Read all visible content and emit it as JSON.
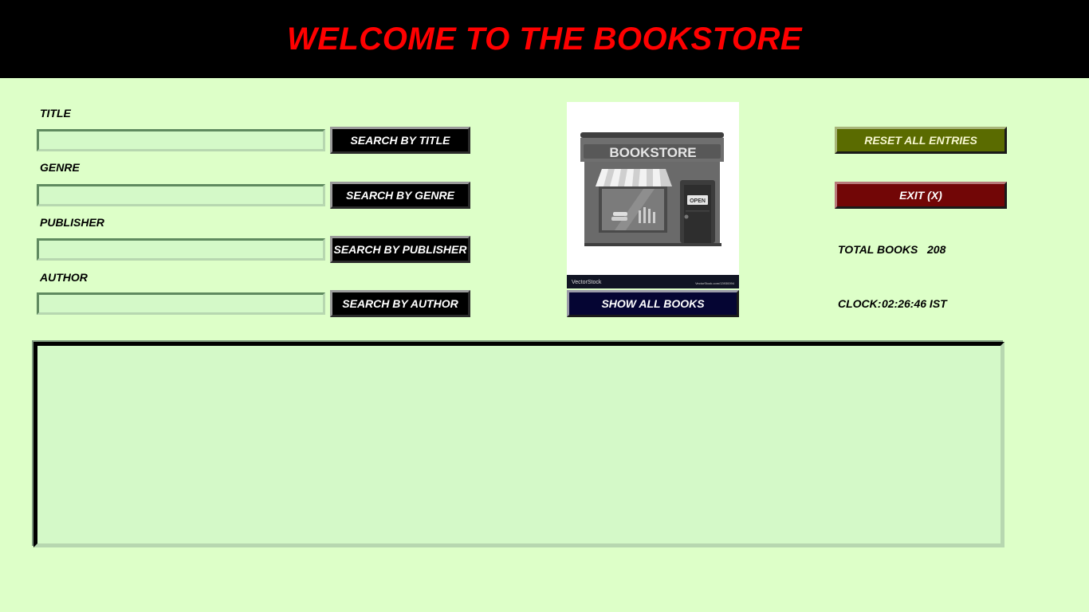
{
  "header": {
    "title": "WELCOME TO THE BOOKSTORE"
  },
  "fields": {
    "title": {
      "label": "TITLE",
      "value": "",
      "button": "SEARCH BY TITLE"
    },
    "genre": {
      "label": "GENRE",
      "value": "",
      "button": "SEARCH BY GENRE"
    },
    "publisher": {
      "label": "PUBLISHER",
      "value": "",
      "button": "SEARCH BY PUBLISHER"
    },
    "author": {
      "label": "AUTHOR",
      "value": "",
      "button": "SEARCH BY AUTHOR"
    }
  },
  "image": {
    "sign": "BOOKSTORE",
    "door_sign": "OPEN",
    "watermark": "VectorStock",
    "watermark_url": "VectorStock.com/13930094",
    "icon": "bookstore-illustration"
  },
  "show_all_button": "SHOW ALL BOOKS",
  "reset_button": "RESET ALL ENTRIES",
  "exit_button": "EXIT (X)",
  "stats": {
    "total_label": "TOTAL BOOKS",
    "total_value": "208",
    "clock_label": "CLOCK:",
    "clock_value": "02:26:46 IST"
  },
  "colors": {
    "background": "#ddffc8",
    "header_bg": "#000000",
    "header_text": "#ff0000",
    "reset": "#5a6b00",
    "exit": "#720606",
    "show_all": "#050533"
  }
}
